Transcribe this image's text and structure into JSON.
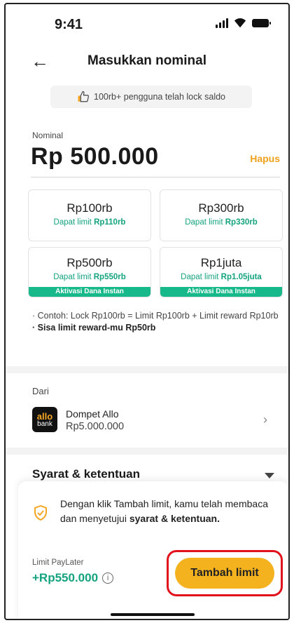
{
  "status_bar": {
    "time": "9:41",
    "icons": [
      "signal-icon",
      "wifi-icon",
      "battery-icon"
    ]
  },
  "header": {
    "back_icon": "arrow-left-icon",
    "title": "Masukkan nominal"
  },
  "info_banner": {
    "icon": "thumbs-up-icon",
    "text": "100rb+ pengguna telah lock saldo"
  },
  "nominal": {
    "label": "Nominal",
    "amount": "Rp 500.000",
    "clear_label": "Hapus"
  },
  "options": [
    {
      "amount": "Rp100rb",
      "limit_prefix": "Dapat limit ",
      "limit_value": "Rp110rb",
      "badge": ""
    },
    {
      "amount": "Rp300rb",
      "limit_prefix": "Dapat limit ",
      "limit_value": "Rp330rb",
      "badge": ""
    },
    {
      "amount": "Rp500rb",
      "limit_prefix": "Dapat limit ",
      "limit_value": "Rp550rb",
      "badge": "Aktivasi Dana Instan"
    },
    {
      "amount": "Rp1juta",
      "limit_prefix": "Dapat limit ",
      "limit_value": "Rp1.05juta",
      "badge": "Aktivasi Dana Instan"
    }
  ],
  "notes": {
    "example": "· Contoh: Lock Rp100rb = Limit Rp100rb + Limit reward Rp10rb",
    "remaining": "· Sisa limit reward-mu Rp50rb"
  },
  "source": {
    "label": "Dari",
    "wallet_name": "Dompet Allo",
    "wallet_balance": "Rp5.000.000",
    "logo_line1": "allo",
    "logo_line2": "bank",
    "chevron_icon": "chevron-right-icon"
  },
  "terms": {
    "title": "Syarat & ketentuan",
    "caret_icon": "caret-down-icon"
  },
  "bottom_sheet": {
    "shield_icon": "shield-check-icon",
    "consent_prefix": "Dengan klik Tambah limit, kamu telah membaca dan menyetujui ",
    "consent_bold": "syarat & ketentuan.",
    "limit_label": "Limit PayLater",
    "limit_value": "+Rp550.000",
    "info_icon_glyph": "i",
    "cta_label": "Tambah limit"
  },
  "colors": {
    "accent_yellow": "#f5b21f",
    "accent_orange": "#f0a11c",
    "green": "#14a37f",
    "badge_green": "#17b889",
    "highlight_red": "#e1121b"
  }
}
